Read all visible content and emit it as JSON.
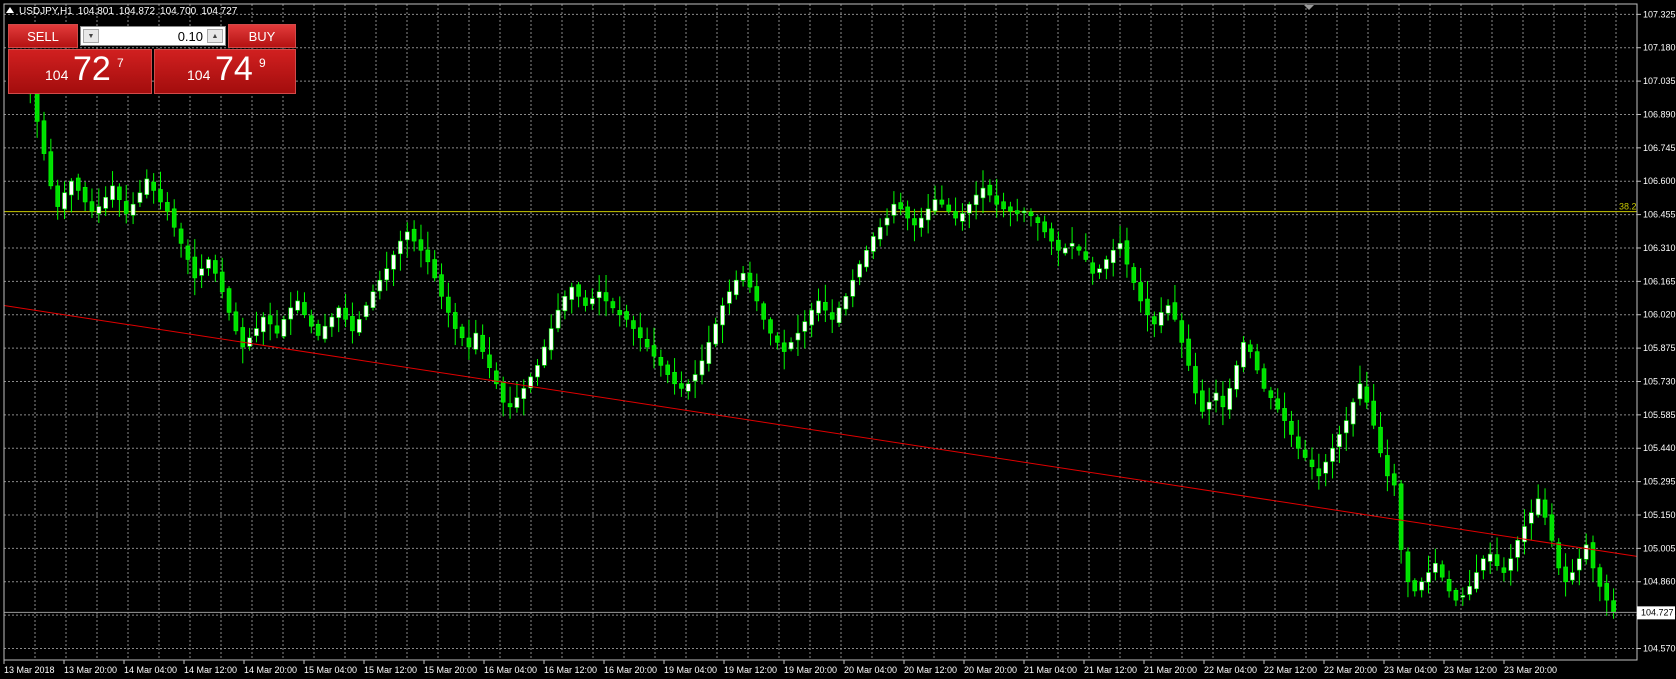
{
  "window": {
    "symbol": "USDJPY,H1",
    "open": "104.801",
    "high": "104.872",
    "low": "104.700",
    "close": "104.727"
  },
  "trade_panel": {
    "sell_label": "SELL",
    "buy_label": "BUY",
    "volume": "0.10",
    "bid": {
      "prefix": "104",
      "big": "72",
      "sup": "7"
    },
    "ask": {
      "prefix": "104",
      "big": "74",
      "sup": "9"
    }
  },
  "colors": {
    "background": "#000000",
    "grid": "#8a8a8a",
    "bull": "#ffffff",
    "bear": "#00e000",
    "outline": "#00ff00",
    "fib_line": "#c8c800",
    "trend_line": "#e00000",
    "panel_red": "#c01818"
  },
  "chart_data": {
    "type": "candlestick",
    "y_ticks": [
      "107.325",
      "107.180",
      "107.035",
      "106.890",
      "106.745",
      "106.600",
      "106.455",
      "106.310",
      "106.165",
      "106.020",
      "105.875",
      "105.730",
      "105.585",
      "105.440",
      "105.295",
      "105.150",
      "105.005",
      "104.860",
      "104.715",
      "104.570"
    ],
    "x_ticks": [
      "13 Mar 2018",
      "13 Mar 20:00",
      "14 Mar 04:00",
      "14 Mar 12:00",
      "14 Mar 20:00",
      "15 Mar 04:00",
      "15 Mar 12:00",
      "15 Mar 20:00",
      "16 Mar 04:00",
      "16 Mar 12:00",
      "16 Mar 20:00",
      "19 Mar 04:00",
      "19 Mar 12:00",
      "19 Mar 20:00",
      "20 Mar 04:00",
      "20 Mar 12:00",
      "20 Mar 20:00",
      "21 Mar 04:00",
      "21 Mar 12:00",
      "21 Mar 20:00",
      "22 Mar 04:00",
      "22 Mar 12:00",
      "22 Mar 20:00",
      "23 Mar 04:00",
      "23 Mar 12:00",
      "23 Mar 20:00"
    ],
    "current_price_label": "104.727",
    "current_price": 104.727,
    "ylim": [
      104.52,
      107.37
    ],
    "fib_level": {
      "label": "38.2",
      "price": 106.468
    },
    "trendline": {
      "start_price": 106.06,
      "end_price": 104.97
    },
    "closes": [
      107.08,
      106.98,
      106.86,
      106.72,
      106.58,
      106.49,
      106.55,
      106.6,
      106.56,
      106.51,
      106.47,
      106.49,
      106.53,
      106.58,
      106.52,
      106.46,
      106.5,
      106.55,
      106.61,
      106.56,
      106.51,
      106.47,
      106.4,
      106.33,
      106.26,
      106.18,
      106.22,
      106.26,
      106.2,
      106.12,
      106.03,
      105.95,
      105.88,
      105.92,
      105.96,
      106.01,
      105.98,
      105.94,
      106.0,
      106.05,
      106.08,
      106.02,
      105.97,
      105.93,
      105.97,
      106.01,
      106.05,
      106.0,
      105.95,
      106.0,
      106.06,
      106.12,
      106.17,
      106.22,
      106.28,
      106.34,
      106.38,
      106.34,
      106.3,
      106.25,
      106.18,
      106.1,
      106.03,
      105.96,
      105.92,
      105.88,
      105.94,
      105.86,
      105.79,
      105.72,
      105.64,
      105.62,
      105.66,
      105.7,
      105.75,
      105.8,
      105.88,
      105.96,
      106.04,
      106.1,
      106.14,
      106.1,
      106.06,
      106.09,
      106.12,
      106.08,
      106.05,
      106.02,
      106.0,
      105.96,
      105.92,
      105.88,
      105.84,
      105.8,
      105.76,
      105.72,
      105.7,
      105.72,
      105.76,
      105.82,
      105.9,
      105.98,
      106.06,
      106.12,
      106.17,
      106.2,
      106.14,
      106.08,
      106.0,
      105.94,
      105.9,
      105.86,
      105.9,
      105.94,
      105.99,
      106.04,
      106.08,
      106.04,
      106.0,
      106.05,
      106.1,
      106.17,
      106.24,
      106.3,
      106.36,
      106.4,
      106.44,
      106.5,
      106.48,
      106.44,
      106.41,
      106.44,
      106.48,
      106.52,
      106.5,
      106.47,
      106.44,
      106.46,
      106.5,
      106.54,
      106.57,
      106.54,
      106.5,
      106.48,
      106.47,
      106.46,
      106.47,
      106.45,
      106.42,
      106.38,
      106.34,
      106.3,
      106.31,
      106.33,
      106.3,
      106.26,
      106.2,
      106.22,
      106.26,
      106.3,
      106.33,
      106.24,
      106.16,
      106.08,
      106.02,
      105.98,
      106.03,
      106.06,
      106.0,
      105.9,
      105.8,
      105.68,
      105.6,
      105.64,
      105.68,
      105.62,
      105.7,
      105.8,
      105.9,
      105.86,
      105.78,
      105.7,
      105.66,
      105.61,
      105.56,
      105.5,
      105.44,
      105.4,
      105.36,
      105.32,
      105.38,
      105.44,
      105.5,
      105.56,
      105.64,
      105.72,
      105.64,
      105.54,
      105.42,
      105.32,
      105.28,
      105.0,
      104.86,
      104.82,
      104.86,
      104.9,
      104.94,
      104.88,
      104.82,
      104.78,
      104.8,
      104.84,
      104.9,
      104.96,
      104.98,
      104.93,
      104.9,
      104.96,
      105.04,
      105.1,
      105.16,
      105.22,
      105.14,
      105.04,
      104.92,
      104.86,
      104.9,
      104.96,
      105.02,
      104.92,
      104.84,
      104.78,
      104.727
    ]
  }
}
